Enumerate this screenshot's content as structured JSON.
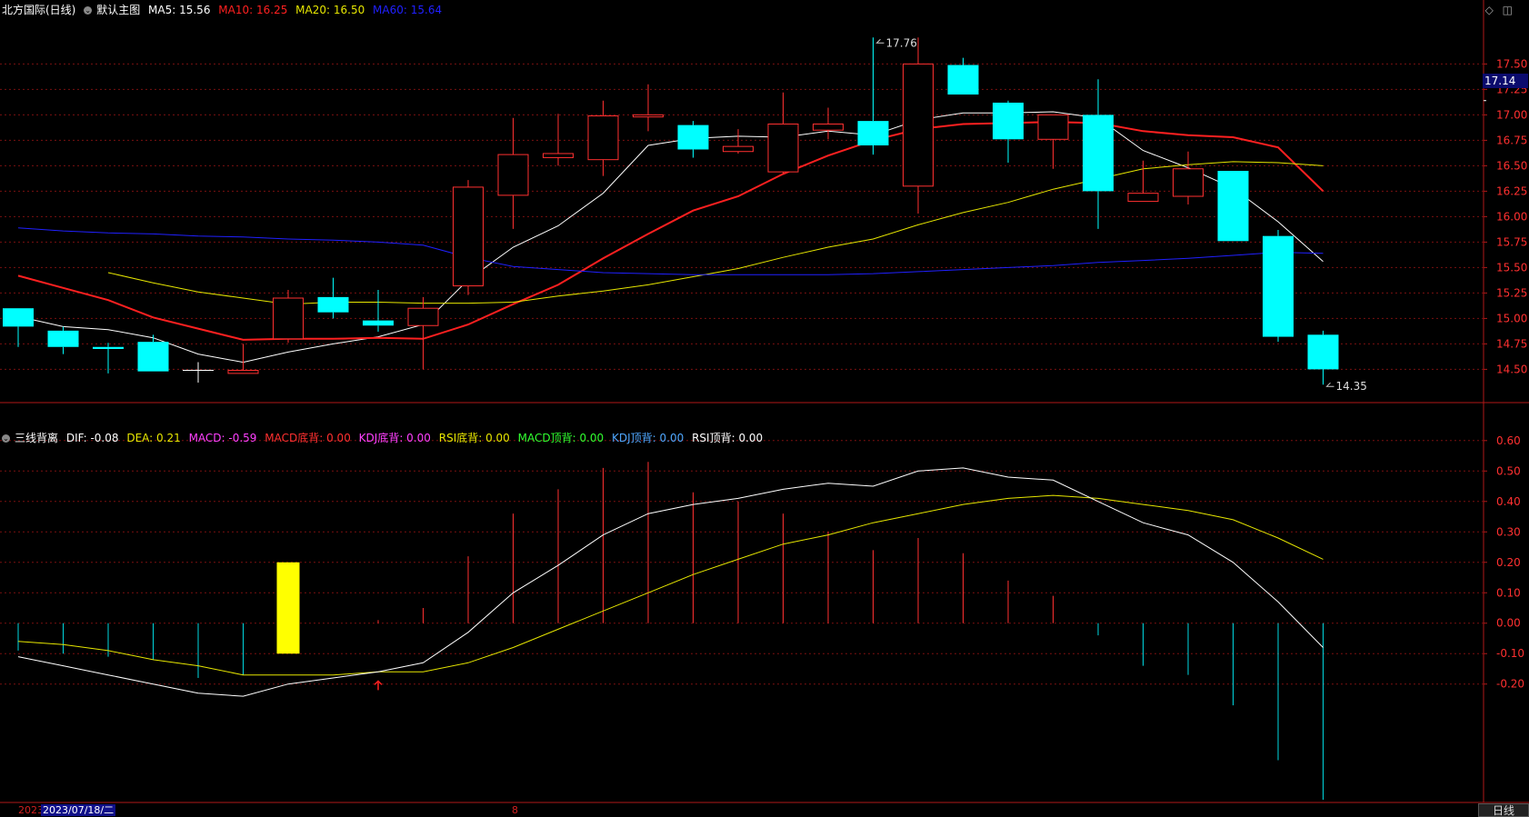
{
  "upper": {
    "stock_title": "北方国际(日线)",
    "template": "默认主图",
    "ma5_label": "MA5: 15.56",
    "ma10_label": "MA10: 16.25",
    "ma20_label": "MA20: 16.50",
    "ma60_label": "MA60: 15.64",
    "current_price": "17.14",
    "high_label": "17.76",
    "low_label": "14.35",
    "colors": {
      "ma5": "#ffffff",
      "ma10": "#ff2020",
      "ma20": "#e6e600",
      "ma60": "#2020ff",
      "up": "#ff3030",
      "down": "#00ffff",
      "grid": "#7a1010"
    }
  },
  "lower": {
    "indicator_name": "三线背离",
    "dif_label": "DIF: -0.08",
    "dea_label": "DEA: 0.21",
    "macd_label": "MACD: -0.59",
    "macd_bottom_div": "MACD底背: 0.00",
    "kdj_bottom_div": "KDJ底背: 0.00",
    "rsi_bottom_div": "RSI底背: 0.00",
    "macd_top_div": "MACD顶背: 0.00",
    "kdj_top_div": "KDJ顶背: 0.00",
    "rsi_top_div": "RSI顶背: 0.00",
    "colors": {
      "dif": "#ffffff",
      "dea": "#e6e600",
      "pos": "#ff3030",
      "neg": "#00d8e0",
      "macd_label": "#ff40ff",
      "bottom_div": "#ff3030",
      "kdj_bottom": "#ff40ff",
      "rsi_bottom": "#e6e600",
      "macd_top": "#30ff30",
      "kdj_top": "#4fa8ff",
      "rsi_top": "#ffffff"
    }
  },
  "footer": {
    "year": "2023",
    "date": "2023/07/18/二",
    "tick": "8",
    "period_tab": "日线"
  },
  "chart_data": [
    {
      "type": "candlestick",
      "title": "北方国际(日线)",
      "ylim": [
        14.2,
        17.95
      ],
      "yticks": [
        "17.50",
        "17.25",
        "17.00",
        "16.75",
        "16.50",
        "16.25",
        "16.00",
        "15.75",
        "15.50",
        "15.25",
        "15.00",
        "14.75",
        "14.50"
      ],
      "candles": [
        {
          "o": 15.1,
          "c": 14.92,
          "h": 15.1,
          "l": 14.72
        },
        {
          "o": 14.88,
          "c": 14.72,
          "h": 14.92,
          "l": 14.65
        },
        {
          "o": 14.72,
          "c": 14.7,
          "h": 14.76,
          "l": 14.46
        },
        {
          "o": 14.77,
          "c": 14.48,
          "h": 14.84,
          "l": 14.48
        },
        {
          "o": 14.49,
          "c": 14.49,
          "h": 14.57,
          "l": 14.37
        },
        {
          "o": 14.46,
          "c": 14.49,
          "h": 14.75,
          "l": 14.46
        },
        {
          "o": 14.8,
          "c": 15.2,
          "h": 15.28,
          "l": 14.76
        },
        {
          "o": 15.21,
          "c": 15.06,
          "h": 15.4,
          "l": 15.0
        },
        {
          "o": 14.98,
          "c": 14.93,
          "h": 15.28,
          "l": 14.87
        },
        {
          "o": 14.93,
          "c": 15.1,
          "h": 15.21,
          "l": 14.5
        },
        {
          "o": 15.32,
          "c": 16.29,
          "h": 16.36,
          "l": 15.23
        },
        {
          "o": 16.21,
          "c": 16.61,
          "h": 16.97,
          "l": 15.88
        },
        {
          "o": 16.58,
          "c": 16.62,
          "h": 17.01,
          "l": 16.5
        },
        {
          "o": 16.56,
          "c": 16.99,
          "h": 17.14,
          "l": 16.4
        },
        {
          "o": 16.98,
          "c": 17.0,
          "h": 17.3,
          "l": 16.84
        },
        {
          "o": 16.9,
          "c": 16.66,
          "h": 16.94,
          "l": 16.58
        },
        {
          "o": 16.64,
          "c": 16.69,
          "h": 16.86,
          "l": 16.62
        },
        {
          "o": 16.44,
          "c": 16.91,
          "h": 17.22,
          "l": 16.42
        },
        {
          "o": 16.85,
          "c": 16.91,
          "h": 17.07,
          "l": 16.76
        },
        {
          "o": 16.94,
          "c": 16.7,
          "h": 17.76,
          "l": 16.61
        },
        {
          "o": 16.3,
          "c": 17.5,
          "h": 17.76,
          "l": 16.03
        },
        {
          "o": 17.49,
          "c": 17.2,
          "h": 17.56,
          "l": 17.2
        },
        {
          "o": 17.12,
          "c": 16.76,
          "h": 17.14,
          "l": 16.53
        },
        {
          "o": 16.76,
          "c": 17.0,
          "h": 17.0,
          "l": 16.47
        },
        {
          "o": 17.0,
          "c": 16.25,
          "h": 17.35,
          "l": 15.88
        },
        {
          "o": 16.15,
          "c": 16.23,
          "h": 16.55,
          "l": 16.15
        },
        {
          "o": 16.2,
          "c": 16.47,
          "h": 16.64,
          "l": 16.12
        },
        {
          "o": 16.45,
          "c": 15.76,
          "h": 16.45,
          "l": 15.76
        },
        {
          "o": 15.81,
          "c": 14.82,
          "h": 15.87,
          "l": 14.77
        },
        {
          "o": 14.84,
          "c": 14.5,
          "h": 14.88,
          "l": 14.35
        }
      ],
      "series": [
        {
          "name": "MA5",
          "values": [
            15.02,
            14.92,
            14.89,
            14.81,
            14.65,
            14.57,
            14.67,
            14.75,
            14.82,
            14.94,
            15.38,
            15.7,
            15.91,
            16.23,
            16.7,
            16.77,
            16.79,
            16.78,
            16.84,
            16.8,
            16.95,
            17.02,
            17.02,
            17.03,
            16.97,
            16.65,
            16.48,
            16.28,
            15.95,
            15.56
          ]
        },
        {
          "name": "MA10",
          "values": [
            15.42,
            15.3,
            15.18,
            15.01,
            14.9,
            14.79,
            14.8,
            14.8,
            14.81,
            14.8,
            14.94,
            15.14,
            15.33,
            15.59,
            15.83,
            16.06,
            16.2,
            16.42,
            16.6,
            16.75,
            16.86,
            16.91,
            16.92,
            16.93,
            16.92,
            16.84,
            16.8,
            16.78,
            16.68,
            16.25
          ]
        },
        {
          "name": "MA20",
          "values": [
            15.45,
            15.35,
            15.26,
            15.2,
            15.14,
            15.16,
            15.16,
            15.15,
            15.15,
            15.16,
            15.22,
            15.27,
            15.33,
            15.41,
            15.49,
            15.6,
            15.7,
            15.78,
            15.92,
            16.04,
            16.14,
            16.27,
            16.37,
            16.47,
            16.51,
            16.54,
            16.53,
            16.5
          ]
        },
        {
          "name": "MA60",
          "values": [
            15.89,
            15.86,
            15.84,
            15.83,
            15.81,
            15.8,
            15.78,
            15.77,
            15.75,
            15.72,
            15.6,
            15.51,
            15.48,
            15.45,
            15.44,
            15.43,
            15.43,
            15.43,
            15.43,
            15.44,
            15.46,
            15.48,
            15.5,
            15.52,
            15.55,
            15.57,
            15.59,
            15.62,
            15.65,
            15.64
          ]
        }
      ]
    },
    {
      "type": "macd",
      "title": "三线背离",
      "ylim": [
        -0.58,
        0.68
      ],
      "yticks": [
        "0.60",
        "0.50",
        "0.40",
        "0.30",
        "0.20",
        "0.10",
        "0.00",
        "-0.10",
        "-0.20"
      ],
      "macd": [
        -0.09,
        -0.1,
        -0.11,
        -0.12,
        -0.18,
        -0.17,
        0.0,
        0.0,
        0.01,
        0.05,
        0.22,
        0.36,
        0.44,
        0.51,
        0.53,
        0.43,
        0.4,
        0.36,
        0.3,
        0.24,
        0.28,
        0.23,
        0.14,
        0.09,
        -0.04,
        -0.14,
        -0.17,
        -0.27,
        -0.45,
        -0.58
      ],
      "dif": [
        -0.11,
        -0.14,
        -0.17,
        -0.2,
        -0.23,
        -0.24,
        -0.2,
        -0.18,
        -0.16,
        -0.13,
        -0.03,
        0.1,
        0.19,
        0.29,
        0.36,
        0.39,
        0.41,
        0.44,
        0.46,
        0.45,
        0.5,
        0.51,
        0.48,
        0.47,
        0.4,
        0.33,
        0.29,
        0.2,
        0.07,
        -0.08
      ],
      "dea": [
        -0.06,
        -0.07,
        -0.09,
        -0.12,
        -0.14,
        -0.17,
        -0.17,
        -0.17,
        -0.16,
        -0.16,
        -0.13,
        -0.08,
        -0.02,
        0.04,
        0.1,
        0.16,
        0.21,
        0.26,
        0.29,
        0.33,
        0.36,
        0.39,
        0.41,
        0.42,
        0.41,
        0.39,
        0.37,
        0.34,
        0.28,
        0.21
      ],
      "signal_bar": {
        "index": 6,
        "top": 0.2,
        "bottom": -0.1
      },
      "bottom_div_arrow_index": 8
    }
  ]
}
